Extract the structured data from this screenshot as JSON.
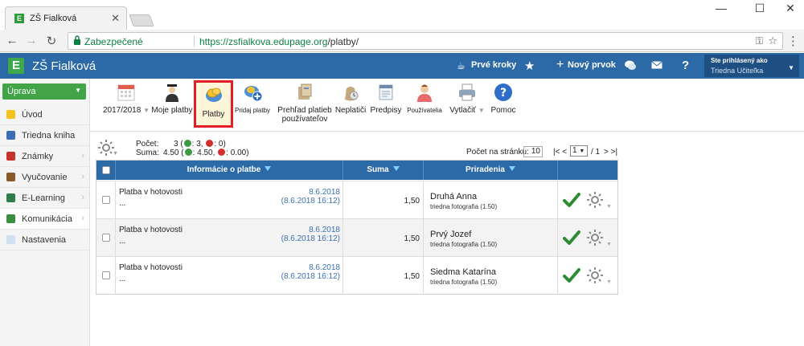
{
  "browser": {
    "tab_title": "ZŠ Fialková",
    "tab_close": "✕",
    "favicon_letter": "E",
    "secure_label": "Zabezpečené",
    "url_scheme": "https://",
    "url_host": "zsfialkova.edupage.org",
    "url_path": "/platby/",
    "win_min": "—",
    "win_max": "☐",
    "win_close": "✕"
  },
  "app": {
    "logo_letter": "E",
    "name": "ZŠ Fialková",
    "header": {
      "first_steps": "Prvé kroky",
      "new_item": "Nový prvok",
      "help": "?",
      "logged_in_as": "Ste prihlásený ako",
      "user_name": "Triedna Učiteľka"
    }
  },
  "sidebar": {
    "edit_button": "Úprava",
    "items": [
      {
        "label": "Úvod",
        "color": "#f4c21f",
        "active": false
      },
      {
        "label": "Triedna kniha",
        "color": "#3d6db5",
        "active": false
      },
      {
        "label": "Známky",
        "color": "#c7332d",
        "active": false
      },
      {
        "label": "Vyučovanie",
        "color": "#8a5a2b",
        "active": false
      },
      {
        "label": "E-Learning",
        "color": "#2e7d4b",
        "active": false
      },
      {
        "label": "Komunikácia",
        "color": "#3a8f3f",
        "active": true
      },
      {
        "label": "Nastavenia",
        "color": "#cfe0f2",
        "active": false
      }
    ]
  },
  "toolbar": {
    "year": "2017/2018",
    "my_payments": "Moje platby",
    "payments": "Platby",
    "add_payment": "Pridaj platby",
    "overview_l1": "Prehľad platieb",
    "overview_l2": "používateľov",
    "nonpayers": "Neplatiči",
    "directives": "Predpisy",
    "users": "Používatelia",
    "print": "Vytlačiť",
    "help": "Pomoc"
  },
  "summary": {
    "count_label": "Počet:",
    "count_value": "3",
    "count_plus": ": 3,",
    "count_minus": ": 0)",
    "sum_label": "Suma:",
    "sum_value": "4.50",
    "sum_plus": ": 4.50,",
    "sum_minus": ": 0.00)",
    "per_page_label": "Počet na stránku:",
    "per_page_value": "10",
    "pager_prev": "|< <",
    "pager_page": "1",
    "pager_total": "/ 1",
    "pager_next": "> >|"
  },
  "table": {
    "columns": {
      "info": "Informácie o platbe",
      "amount": "Suma",
      "assign": "Priradenia"
    },
    "rows": [
      {
        "type": "Platba v hotovosti",
        "dots": "...",
        "date": "8.6.2018",
        "datetime": "(8.6.2018 16:12)",
        "amount": "1,50",
        "name": "Druhá Anna",
        "detail": "triedna fotografia (1.50)"
      },
      {
        "type": "Platba v hotovosti",
        "dots": "...",
        "date": "8.6.2018",
        "datetime": "(8.6.2018 16:12)",
        "amount": "1,50",
        "name": "Prvý Jozef",
        "detail": "triedna fotografia (1.50)"
      },
      {
        "type": "Platba v hotovosti",
        "dots": "...",
        "date": "8.6.2018",
        "datetime": "(8.6.2018 16:12)",
        "amount": "1,50",
        "name": "Siedma Katarína",
        "detail": "triedna fotografia (1.50)"
      }
    ]
  },
  "colors": {
    "header_blue": "#2c6aa7",
    "accent_green": "#41a447",
    "highlight_red": "#e21f26"
  }
}
